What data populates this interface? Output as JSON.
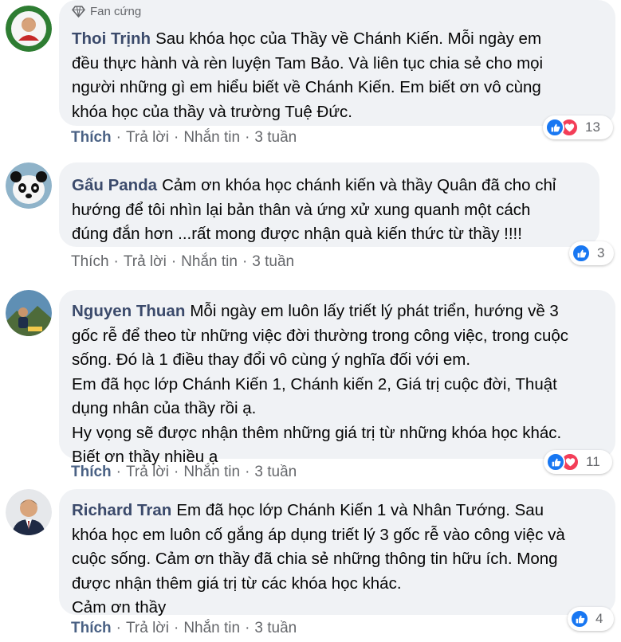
{
  "comments": [
    {
      "author": "Thoi Trịnh",
      "badge": "Fan cứng",
      "lines": [
        "Sau khóa học của Thầy về Chánh Kiến. Mỗi ngày em",
        "đều thực hành và rèn luyện Tam Bảo. Và liên tục chia sẻ cho mọi",
        "người những gì em hiểu biết về Chánh Kiến. Em biết ơn vô cùng",
        "khóa học của thầy và trường Tuệ Đức."
      ],
      "actions": {
        "like": "Thích",
        "reply": "Trả lời",
        "message": "Nhắn tin",
        "time": "3 tuần"
      },
      "reaction_icons": [
        "like-icon",
        "love-icon"
      ],
      "reaction_count": "13"
    },
    {
      "author": "Gấu Panda",
      "lines": [
        "Cảm ơn khóa học chánh kiến và thầy Quân đã cho chỉ",
        "hướng để tôi nhìn lại bản thân và ứng xử xung quanh một cách",
        "đúng đắn hơn ...rất mong được nhận quà kiến thức từ thầy !!!!"
      ],
      "actions": {
        "like": "Thích",
        "reply": "Trả lời",
        "message": "Nhắn tin",
        "time": "3 tuần"
      },
      "reaction_icons": [
        "like-icon"
      ],
      "reaction_count": "3"
    },
    {
      "author": "Nguyen Thuan",
      "lines": [
        "Mỗi ngày em luôn lấy triết lý phát triển, hướng về 3",
        "gốc rễ để theo từ những việc đời thường trong công việc, trong cuộc",
        "sống. Đó là 1 điều thay đổi vô cùng ý nghĩa đối với em.",
        "Em đã học lớp Chánh Kiến 1, Chánh kiến 2, Giá trị cuộc đời, Thuật",
        "dụng nhân của thầy rồi ạ.",
        "Hy vọng sẽ được nhận thêm những giá trị từ những khóa học khác.",
        "Biết ơn thầy nhiều ạ"
      ],
      "actions": {
        "like": "Thích",
        "reply": "Trả lời",
        "message": "Nhắn tin",
        "time": "3 tuần"
      },
      "reaction_icons": [
        "like-icon",
        "love-icon"
      ],
      "reaction_count": "11"
    },
    {
      "author": "Richard Tran",
      "lines": [
        "Em đã học lớp Chánh Kiến 1 và Nhân Tướng. Sau",
        "khóa học em luôn cố gắng áp dụng triết lý 3 gốc rễ vào công việc và",
        "cuộc sống. Cảm ơn thầy đã chia sẻ những thông tin hữu ích. Mong",
        "được nhận thêm giá trị từ các khóa học khác.",
        "Cảm ơn thầy"
      ],
      "actions": {
        "like": "Thích",
        "reply": "Trả lời",
        "message": "Nhắn tin",
        "time": "3 tuần"
      },
      "reaction_icons": [
        "like-icon"
      ],
      "reaction_count": "4"
    }
  ],
  "colors": {
    "bubble": "#f0f2f5",
    "author": "#3b4a6b",
    "meta": "#65676b",
    "like_blue": "#1877f2",
    "love_red": "#f33e58"
  }
}
